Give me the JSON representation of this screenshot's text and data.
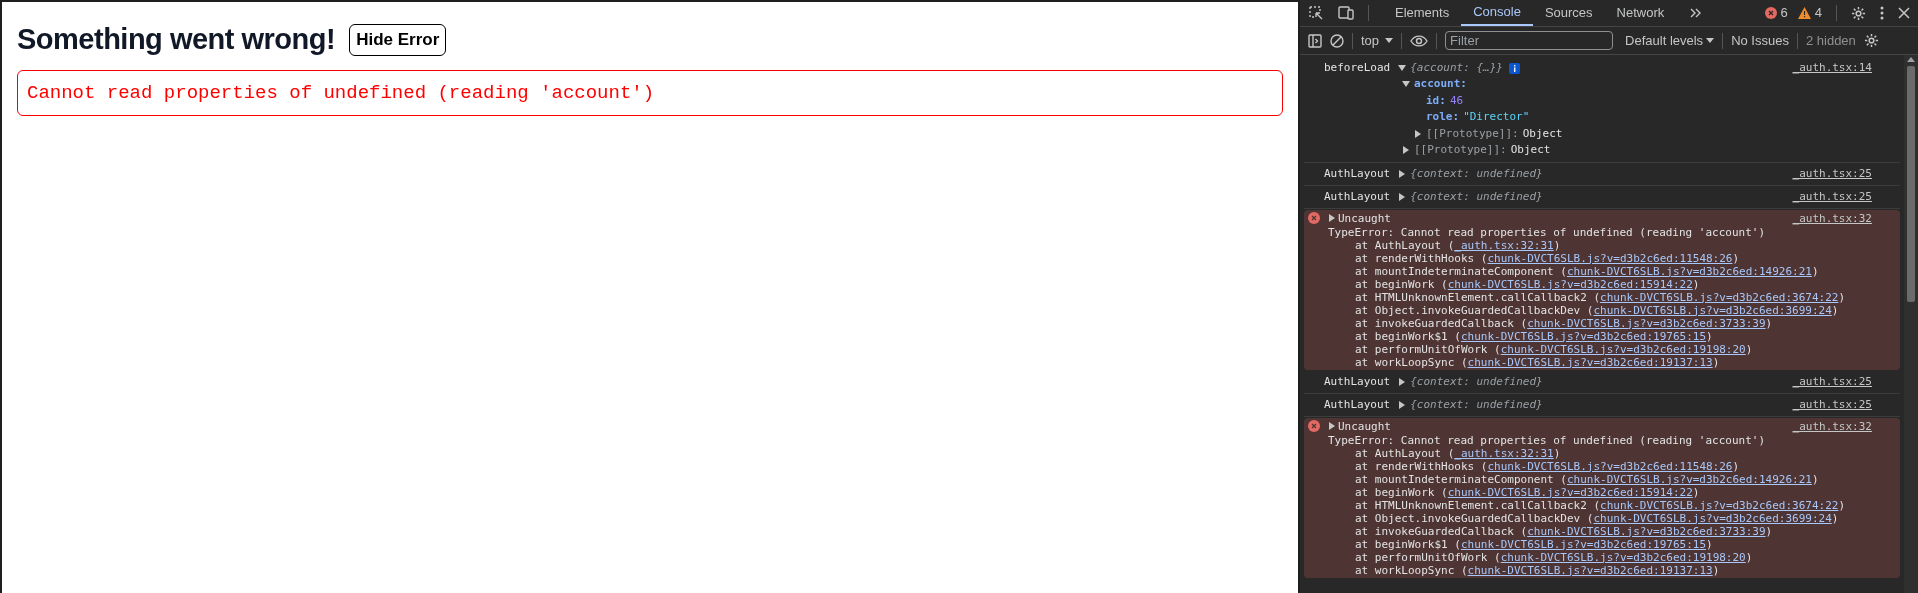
{
  "page": {
    "heading": "Something went wrong!",
    "hide_button": "Hide Error",
    "error_message": "Cannot read properties of undefined (reading 'account')"
  },
  "devtools": {
    "tabs": [
      {
        "label": "Elements",
        "selected": false
      },
      {
        "label": "Console",
        "selected": true
      },
      {
        "label": "Sources",
        "selected": false
      },
      {
        "label": "Network",
        "selected": false
      }
    ],
    "error_count": "6",
    "warning_count": "4",
    "toolbar": {
      "context": "top",
      "filter_placeholder": "Filter",
      "levels": "Default levels",
      "issues": "No Issues",
      "hidden": "2 hidden"
    },
    "messages": [
      {
        "kind": "object",
        "label": "beforeLoad",
        "summary": "{account: {…}}",
        "source": "_auth.tsx:14",
        "expanded": true,
        "children": [
          {
            "key": "account:",
            "kind": "property",
            "expanded": true,
            "children": [
              {
                "key": "id:",
                "value": "46",
                "kind": "number"
              },
              {
                "key": "role:",
                "value": "\"Director\"",
                "kind": "string"
              },
              {
                "key": "[[Prototype]]:",
                "value": "Object",
                "kind": "internal",
                "expanded": false
              }
            ]
          },
          {
            "key": "[[Prototype]]:",
            "value": "Object",
            "kind": "internal",
            "expanded": false
          }
        ]
      },
      {
        "kind": "log",
        "label": "AuthLayout",
        "summary": "{context: undefined}",
        "source": "_auth.tsx:25",
        "expanded": false
      },
      {
        "kind": "log",
        "label": "AuthLayout",
        "summary": "{context: undefined}",
        "source": "_auth.tsx:25",
        "expanded": false
      },
      {
        "kind": "error",
        "title": "Uncaught",
        "source": "_auth.tsx:32",
        "message": "TypeError: Cannot read properties of undefined (reading 'account')",
        "stack": [
          {
            "prefix": "at AuthLayout (",
            "link": "_auth.tsx:32:31",
            "suffix": ")"
          },
          {
            "prefix": "at renderWithHooks (",
            "link": "chunk-DVCT6SLB.js?v=d3b2c6ed:11548:26",
            "suffix": ")"
          },
          {
            "prefix": "at mountIndeterminateComponent (",
            "link": "chunk-DVCT6SLB.js?v=d3b2c6ed:14926:21",
            "suffix": ")"
          },
          {
            "prefix": "at beginWork (",
            "link": "chunk-DVCT6SLB.js?v=d3b2c6ed:15914:22",
            "suffix": ")"
          },
          {
            "prefix": "at HTMLUnknownElement.callCallback2 (",
            "link": "chunk-DVCT6SLB.js?v=d3b2c6ed:3674:22",
            "suffix": ")"
          },
          {
            "prefix": "at Object.invokeGuardedCallbackDev (",
            "link": "chunk-DVCT6SLB.js?v=d3b2c6ed:3699:24",
            "suffix": ")"
          },
          {
            "prefix": "at invokeGuardedCallback (",
            "link": "chunk-DVCT6SLB.js?v=d3b2c6ed:3733:39",
            "suffix": ")"
          },
          {
            "prefix": "at beginWork$1 (",
            "link": "chunk-DVCT6SLB.js?v=d3b2c6ed:19765:15",
            "suffix": ")"
          },
          {
            "prefix": "at performUnitOfWork (",
            "link": "chunk-DVCT6SLB.js?v=d3b2c6ed:19198:20",
            "suffix": ")"
          },
          {
            "prefix": "at workLoopSync (",
            "link": "chunk-DVCT6SLB.js?v=d3b2c6ed:19137:13",
            "suffix": ")"
          }
        ]
      },
      {
        "kind": "log",
        "label": "AuthLayout",
        "summary": "{context: undefined}",
        "source": "_auth.tsx:25",
        "expanded": false
      },
      {
        "kind": "log",
        "label": "AuthLayout",
        "summary": "{context: undefined}",
        "source": "_auth.tsx:25",
        "expanded": false
      },
      {
        "kind": "error",
        "title": "Uncaught",
        "source": "_auth.tsx:32",
        "message": "TypeError: Cannot read properties of undefined (reading 'account')",
        "stack": [
          {
            "prefix": "at AuthLayout (",
            "link": "_auth.tsx:32:31",
            "suffix": ")"
          },
          {
            "prefix": "at renderWithHooks (",
            "link": "chunk-DVCT6SLB.js?v=d3b2c6ed:11548:26",
            "suffix": ")"
          },
          {
            "prefix": "at mountIndeterminateComponent (",
            "link": "chunk-DVCT6SLB.js?v=d3b2c6ed:14926:21",
            "suffix": ")"
          },
          {
            "prefix": "at beginWork (",
            "link": "chunk-DVCT6SLB.js?v=d3b2c6ed:15914:22",
            "suffix": ")"
          },
          {
            "prefix": "at HTMLUnknownElement.callCallback2 (",
            "link": "chunk-DVCT6SLB.js?v=d3b2c6ed:3674:22",
            "suffix": ")"
          },
          {
            "prefix": "at Object.invokeGuardedCallbackDev (",
            "link": "chunk-DVCT6SLB.js?v=d3b2c6ed:3699:24",
            "suffix": ")"
          },
          {
            "prefix": "at invokeGuardedCallback (",
            "link": "chunk-DVCT6SLB.js?v=d3b2c6ed:3733:39",
            "suffix": ")"
          },
          {
            "prefix": "at beginWork$1 (",
            "link": "chunk-DVCT6SLB.js?v=d3b2c6ed:19765:15",
            "suffix": ")"
          },
          {
            "prefix": "at performUnitOfWork (",
            "link": "chunk-DVCT6SLB.js?v=d3b2c6ed:19198:20",
            "suffix": ")"
          },
          {
            "prefix": "at workLoopSync (",
            "link": "chunk-DVCT6SLB.js?v=d3b2c6ed:19137:13",
            "suffix": ")"
          }
        ]
      }
    ]
  }
}
